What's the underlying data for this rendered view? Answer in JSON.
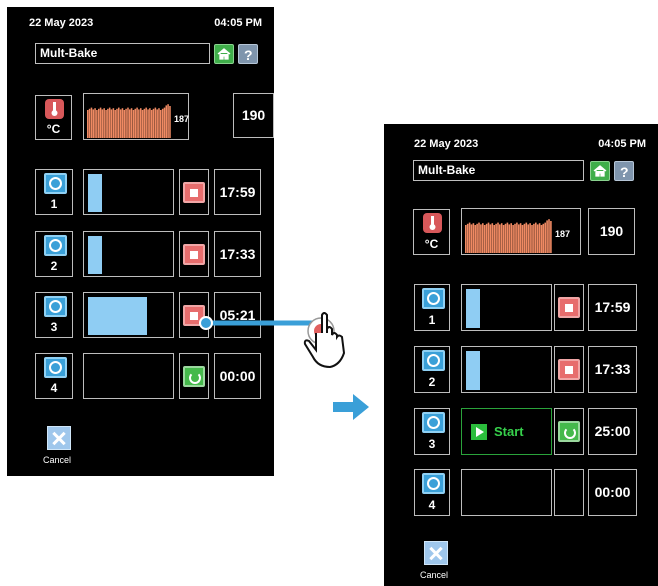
{
  "left": {
    "date": "22 May 2023",
    "time": "04:05 PM",
    "program": "Mult-Bake",
    "temperature": {
      "unit": "°C",
      "graph_value": "187",
      "setpoint": "190"
    },
    "timers": [
      {
        "number": "1",
        "value": "17:59",
        "progress": 0.2,
        "action": "stop"
      },
      {
        "number": "2",
        "value": "17:33",
        "progress": 0.2,
        "action": "stop"
      },
      {
        "number": "3",
        "value": "05:21",
        "progress": 0.7,
        "action": "stop"
      },
      {
        "number": "4",
        "value": "00:00",
        "progress": 0,
        "action": "restart"
      }
    ],
    "cancel_label": "Cancel"
  },
  "right": {
    "date": "22 May 2023",
    "time": "04:05 PM",
    "program": "Mult-Bake",
    "temperature": {
      "unit": "°C",
      "graph_value": "187",
      "setpoint": "190"
    },
    "timers": [
      {
        "number": "1",
        "value": "17:59",
        "progress": 0.2,
        "action": "stop"
      },
      {
        "number": "2",
        "value": "17:33",
        "progress": 0.2,
        "action": "stop"
      },
      {
        "number": "3",
        "value": "25:00",
        "start_label": "Start",
        "action": "restart"
      },
      {
        "number": "4",
        "value": "00:00",
        "progress": 0,
        "action": "none"
      }
    ],
    "cancel_label": "Cancel"
  },
  "colors": {
    "accent_blue": "#8fcdf3",
    "stop_red": "#e76d6d",
    "go_green": "#45b94b",
    "start_green": "#36d04b",
    "graph_orange": "#f08a63",
    "arrow_blue": "#3a9fd8"
  }
}
